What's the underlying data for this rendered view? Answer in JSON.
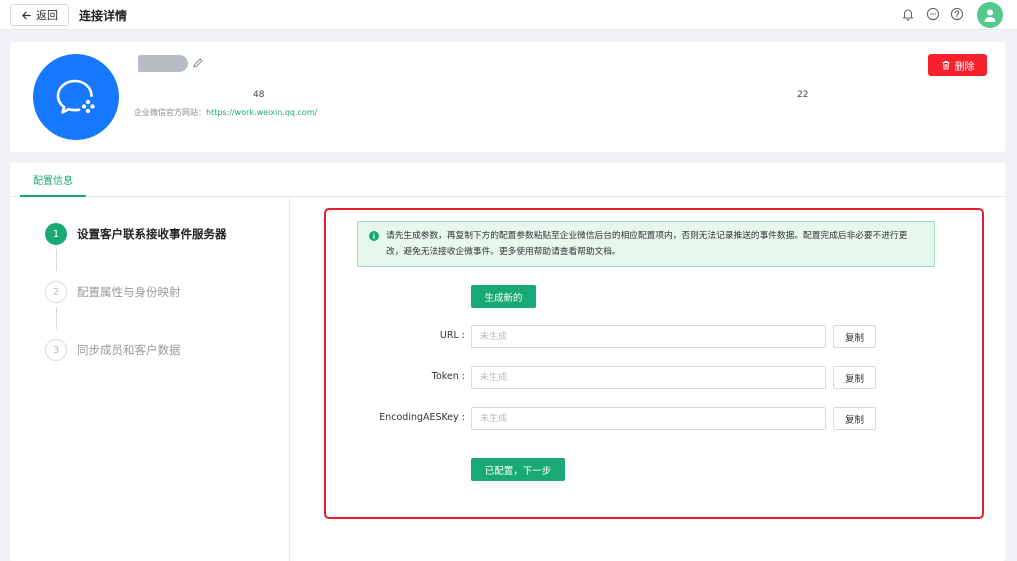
{
  "topbar": {
    "back_label": "返回",
    "title": "连接详情",
    "icons": [
      "bell-icon",
      "message-icon",
      "help-icon",
      "user-avatar-icon"
    ]
  },
  "header": {
    "meta_value_1": "48",
    "meta_value_2": "22",
    "site_label": "企业微信官方网站：",
    "site_url": "https://work.weixin.qq.com/",
    "delete_label": "删除",
    "logo_color": "#1677ff"
  },
  "main": {
    "tab_label": "配置信息",
    "steps": [
      {
        "number": "1",
        "label": "设置客户联系接收事件服务器",
        "active": true
      },
      {
        "number": "2",
        "label": "配置属性与身份映射",
        "active": false
      },
      {
        "number": "3",
        "label": "同步成员和客户数据",
        "active": false
      }
    ],
    "alert_text": "请先生成参数，再复制下方的配置参数粘贴至企业微信后台的相应配置项内，否则无法记录推送的事件数据。配置完成后非必要不进行更改，避免无法接收企微事件。更多使用帮助请查看帮助文档。",
    "generate_label": "生成新的",
    "fields": [
      {
        "label": "URL :",
        "placeholder": "未生成",
        "copy_label": "复制"
      },
      {
        "label": "Token :",
        "placeholder": "未生成",
        "copy_label": "复制"
      },
      {
        "label": "EncodingAESKey :",
        "placeholder": "未生成",
        "copy_label": "复制"
      }
    ],
    "next_label": "已配置，下一步"
  },
  "colors": {
    "primary": "#19a974",
    "danger": "#f5222d",
    "highlight": "#e5202e"
  }
}
